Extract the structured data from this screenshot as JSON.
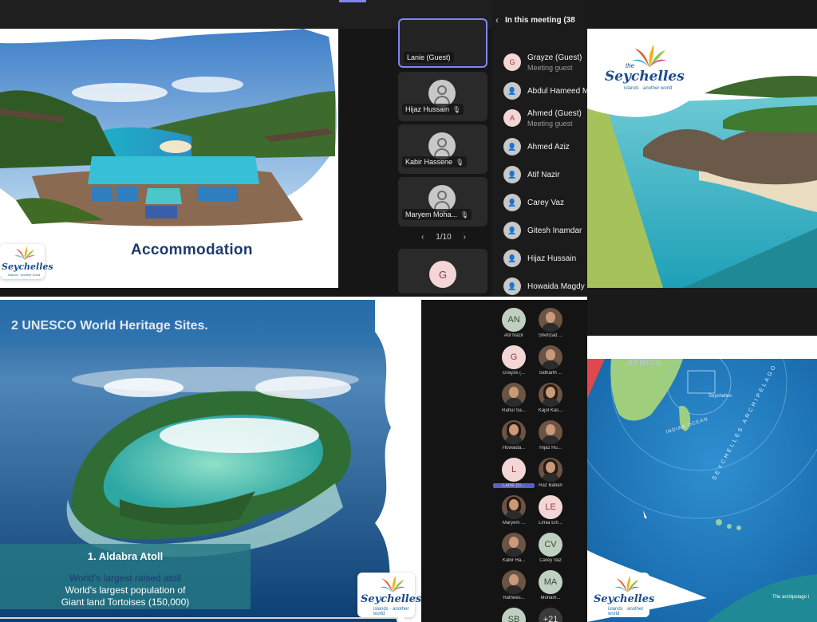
{
  "top_left": {
    "slide_title": "Accommodation",
    "tiles": [
      {
        "name": "Lanie (Guest)"
      },
      {
        "name": "Hijaz Hussain"
      },
      {
        "name": "Kabir Hassene"
      },
      {
        "name": "Maryem Moha..."
      }
    ],
    "pager": {
      "prev": "‹",
      "label": "1/10",
      "next": "›"
    },
    "g_avatar": "G"
  },
  "meeting_panel": {
    "back": "‹",
    "header": "In this meeting (38",
    "people": [
      {
        "initial": "G",
        "name": "Grayze (Guest)",
        "sub": "Meeting guest"
      },
      {
        "initial": "",
        "name": "Abdul Hameed M",
        "sub": ""
      },
      {
        "initial": "A",
        "name": "Ahmed (Guest)",
        "sub": "Meeting guest"
      },
      {
        "initial": "",
        "name": "Ahmed Aziz",
        "sub": ""
      },
      {
        "initial": "",
        "name": "Atif Nazir",
        "sub": ""
      },
      {
        "initial": "",
        "name": "Carey Vaz",
        "sub": ""
      },
      {
        "initial": "",
        "name": "Gitesh Inamdar",
        "sub": ""
      },
      {
        "initial": "",
        "name": "Hijaz Hussain",
        "sub": ""
      },
      {
        "initial": "",
        "name": "Howaida Magdy",
        "sub": ""
      }
    ]
  },
  "logo": {
    "the": "the",
    "word": "Seychelles",
    "sub": "islands · another world"
  },
  "unesco_slide": {
    "title": "2 UNESCO World Heritage Sites.",
    "box_title": "1. Aldabra Atoll",
    "line1": "World's largest raised atoll",
    "line2": "World's largest population of",
    "line3": "Giant land Tortoises (150,000)"
  },
  "grid": [
    {
      "initials": "AN",
      "name": "Atif Nazir",
      "kind": "initials"
    },
    {
      "initials": "",
      "name": "Shehzad ...",
      "kind": "photo"
    },
    {
      "initials": "G",
      "name": "Grayze (...",
      "kind": "gpink"
    },
    {
      "initials": "",
      "name": "Sidharth ...",
      "kind": "photo"
    },
    {
      "initials": "",
      "name": "Rahul Sa...",
      "kind": "photo"
    },
    {
      "initials": "",
      "name": "Kajol Kas...",
      "kind": "photo-f"
    },
    {
      "initials": "",
      "name": "Howaida...",
      "kind": "photo-f"
    },
    {
      "initials": "",
      "name": "Hijaz Hu...",
      "kind": "photo"
    },
    {
      "initials": "L",
      "name": "Lanie (G...",
      "kind": "gpink"
    },
    {
      "initials": "",
      "name": "Raz Baban",
      "kind": "photo-f"
    },
    {
      "initials": "",
      "name": "Maryem ...",
      "kind": "photo-f"
    },
    {
      "initials": "LE",
      "name": "Limia Elh...",
      "kind": "gpink"
    },
    {
      "initials": "",
      "name": "Kabir Ha...",
      "kind": "photo"
    },
    {
      "initials": "CV",
      "name": "Carey Vaz",
      "kind": "initials"
    },
    {
      "initials": "",
      "name": "Rathees...",
      "kind": "photo"
    },
    {
      "initials": "MA",
      "name": "Moham...",
      "kind": "initials"
    },
    {
      "initials": "SB",
      "name": "",
      "kind": "initials"
    },
    {
      "initials": "+21",
      "name": "",
      "kind": "more"
    }
  ],
  "map_slide": {
    "africa": "AFRICA",
    "seychelles_label": "Seychelles",
    "ocean": "INDIAN OCEAN",
    "archipelago": "SEYCHELLES ARCHIPELAGO",
    "caption": "The archipelago i"
  },
  "colors": {
    "teams_accent": "#7f85f5",
    "logo_blue": "#1b4b8f",
    "aldabra_box": "#247882",
    "slide_title": "#1f3a6b",
    "lime": "#a6c25a",
    "teal": "#1f8a95"
  }
}
